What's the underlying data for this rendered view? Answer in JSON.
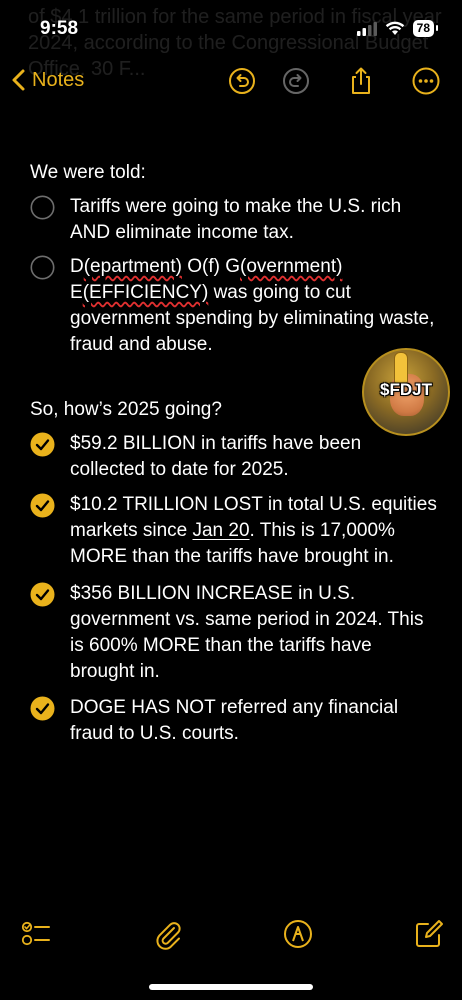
{
  "status_bar": {
    "time": "9:58",
    "battery": "78"
  },
  "background_text": "of $4.1 trillion for the same period in fiscal year 2024, according to the Congressional Budget Office. 30 F...",
  "nav": {
    "back_label": "Notes"
  },
  "note": {
    "section1_title": "We were told:",
    "section1_items": [
      {
        "text": "Tariffs were going to make the U.S. rich AND eliminate income tax.",
        "checked": false
      },
      {
        "parts": [
          "D",
          "(epartment)",
          " O(f) G",
          "(overnment)",
          " E",
          "(EFFICIENCY)",
          " was going to cut government spending by eliminating waste, fraud and abuse."
        ],
        "checked": false
      }
    ],
    "section2_title": "So, how’s 2025 going?",
    "section2_items": [
      {
        "text": "$59.2 BILLION in tariffs have been collected to date for 2025.",
        "checked": true
      },
      {
        "before": "$10.2 TRILLION LOST in total U.S. equities markets since ",
        "link": "Jan 20",
        "after": ". This is 17,000% MORE than the tariffs have brought in.",
        "checked": true
      },
      {
        "text": "$356 BILLION INCREASE in U.S. government vs. same period in 2024. This is 600% MORE than the tariffs have brought in.",
        "checked": true
      },
      {
        "text": "DOGE HAS NOT referred any financial fraud to U.S. courts.",
        "checked": true
      }
    ]
  },
  "sticker": {
    "text": "$FDJT"
  },
  "colors": {
    "accent": "#e9b21c",
    "background": "#000000",
    "text": "#ffffff",
    "spellcheck": "#e03030"
  },
  "icons": {
    "nav": [
      "chevron-left-icon",
      "undo-icon",
      "redo-icon",
      "share-icon",
      "more-icon"
    ],
    "toolbar": [
      "checklist-icon",
      "paperclip-icon",
      "markup-pen-icon",
      "compose-icon"
    ]
  }
}
